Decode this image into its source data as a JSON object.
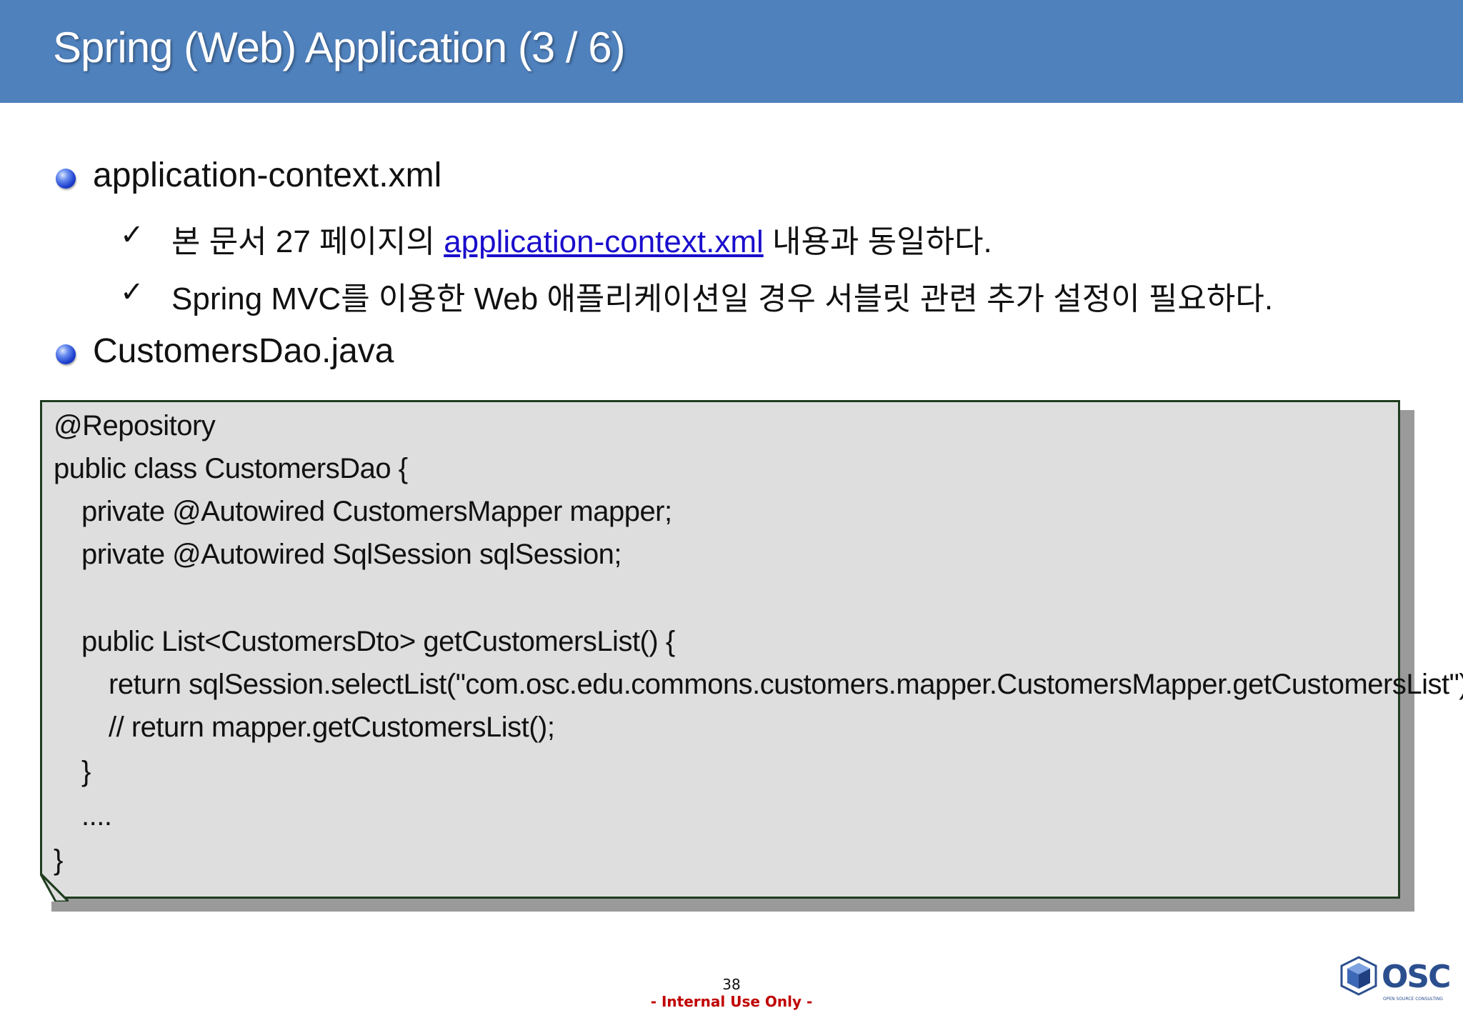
{
  "title": "Spring (Web) Application (3 / 6)",
  "bullets": [
    {
      "text": "application-context.xml",
      "subitems": [
        {
          "before": "본 문서 27 페이지의 ",
          "link": "application-context.xml",
          "after": " 내용과 동일하다."
        },
        {
          "text": "Spring MVC를 이용한 Web 애플리케이션일 경우 서블릿 관련 추가 설정이 필요하다."
        }
      ]
    },
    {
      "text": "CustomersDao.java"
    }
  ],
  "code": [
    "@Repository",
    "public class CustomersDao {",
    "private @Autowired CustomersMapper mapper;",
    "private @Autowired SqlSession sqlSession;",
    "public List<CustomersDto> getCustomersList() {",
    "return sqlSession.selectList(\"com.osc.edu.commons.customers.mapper.CustomersMapper.getCustomersList\");",
    "// return mapper.getCustomersList();",
    "}",
    "....",
    "}"
  ],
  "footer": {
    "page_number": "38",
    "notice": "- Internal Use Only -"
  },
  "logo": {
    "text": "OSC",
    "tagline": "OPEN SOURCE CONSULTING"
  },
  "colors": {
    "title_bar": "#4f81bd",
    "code_background": "#dedede",
    "code_border": "#1f3d1f",
    "link": "#1a0dcc",
    "notice": "#c00000"
  },
  "icons": [
    "blue-sphere-bullet-icon",
    "checkmark-icon",
    "osc-logo-icon"
  ]
}
